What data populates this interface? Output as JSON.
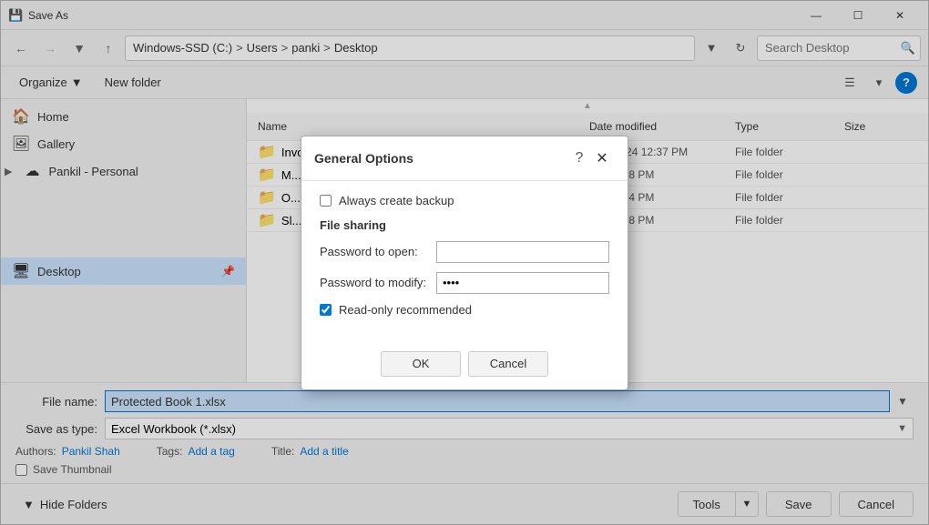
{
  "window": {
    "title": "Save As",
    "icon": "💾"
  },
  "addressbar": {
    "back_tooltip": "Back",
    "forward_tooltip": "Forward",
    "up_tooltip": "Up",
    "path": {
      "drive": "Windows-SSD (C:)",
      "users": "Users",
      "user": "panki",
      "folder": "Desktop"
    },
    "search_placeholder": "Search Desktop"
  },
  "toolbar": {
    "organize_label": "Organize",
    "new_folder_label": "New folder"
  },
  "sidebar": {
    "items": [
      {
        "id": "home",
        "label": "Home",
        "icon": "🏠"
      },
      {
        "id": "gallery",
        "label": "Gallery",
        "icon": "🖼"
      },
      {
        "id": "pankil-personal",
        "label": "Pankil - Personal",
        "icon": "☁",
        "expandable": true
      }
    ],
    "desktop": {
      "label": "Desktop",
      "icon": "🖥",
      "pinned": true
    }
  },
  "filelist": {
    "columns": {
      "name": "Name",
      "date_modified": "Date modified",
      "type": "Type",
      "size": "Size"
    },
    "scroll_indicator": "▲",
    "files": [
      {
        "name": "Invoices",
        "date": "10/6/2024 12:37 PM",
        "type": "File folder",
        "size": ""
      },
      {
        "name": "M...",
        "date": "...24 2:48 PM",
        "type": "File folder",
        "size": ""
      },
      {
        "name": "O...",
        "date": "...24 2:14 PM",
        "type": "File folder",
        "size": ""
      },
      {
        "name": "Sl...",
        "date": "...24 3:38 PM",
        "type": "File folder",
        "size": ""
      }
    ]
  },
  "bottom": {
    "filename_label": "File name:",
    "filename_value": "Protected Book 1.xlsx",
    "savetype_label": "Save as type:",
    "savetype_value": "Excel Workbook (*.xlsx)",
    "authors_label": "Authors:",
    "authors_value": "Pankil Shah",
    "tags_label": "Tags:",
    "tags_placeholder": "Add a tag",
    "title_label": "Title:",
    "title_placeholder": "Add a title",
    "thumbnail_label": "Save Thumbnail"
  },
  "footer": {
    "hide_folders_label": "Hide Folders",
    "tools_label": "Tools",
    "save_label": "Save",
    "cancel_label": "Cancel"
  },
  "modal": {
    "title": "General Options",
    "always_backup_label": "Always create backup",
    "file_sharing_label": "File sharing",
    "open_label": "Password to open:",
    "modify_label": "Password to modify:",
    "modify_value": "••••",
    "readonly_label": "Read-only recommended",
    "ok_label": "OK",
    "cancel_label": "Cancel"
  }
}
